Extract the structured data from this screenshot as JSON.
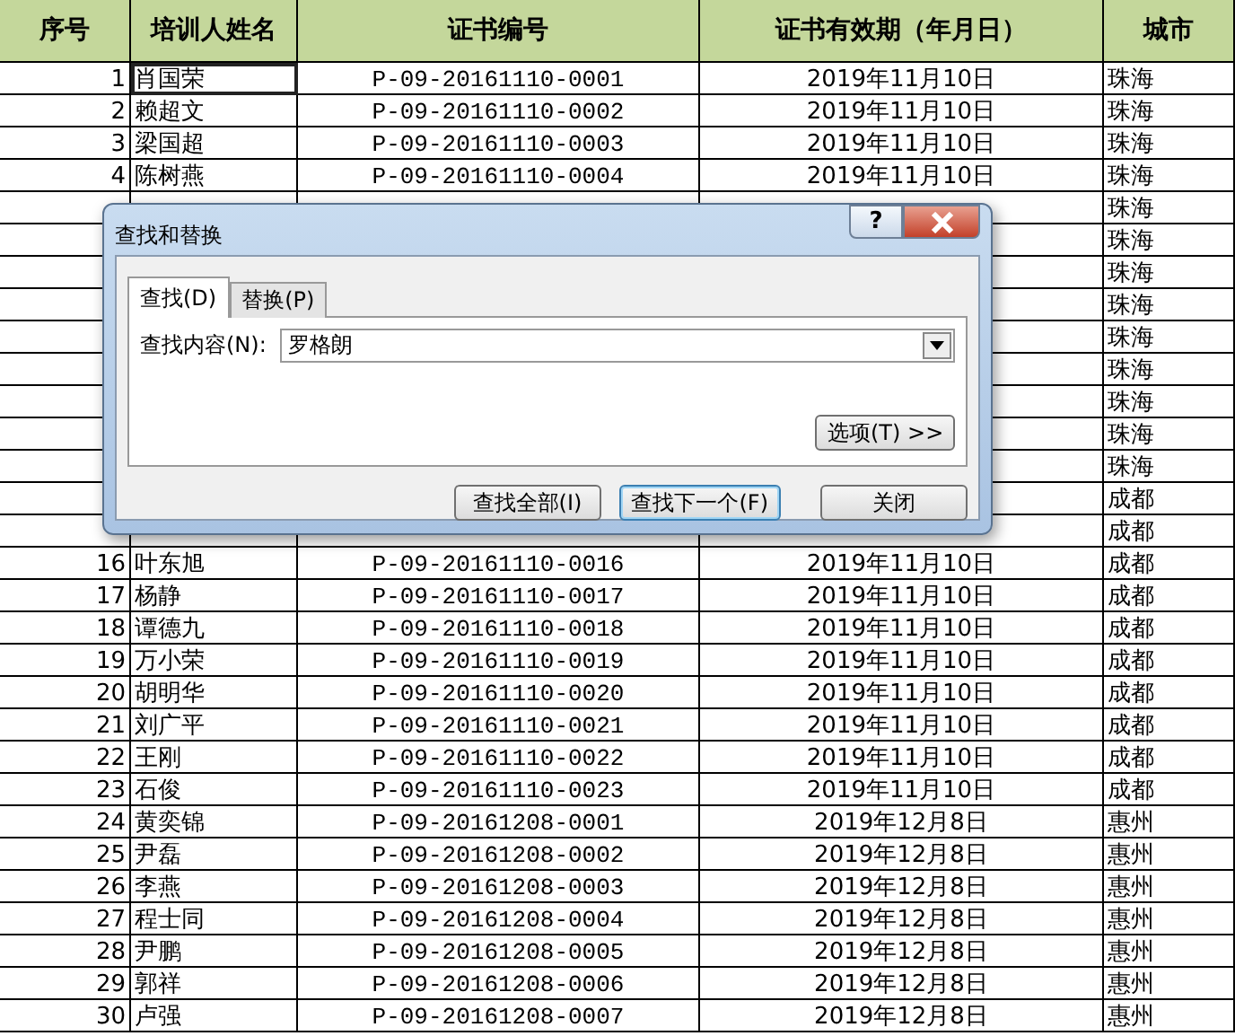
{
  "table": {
    "columns": [
      "序号",
      "培训人姓名",
      "证书编号",
      "证书有效期（年月日）",
      "城市"
    ],
    "rows": [
      {
        "seq": "1",
        "name": "肖国荣",
        "cert": "P-09-20161110-0001",
        "date": "2019年11月10日",
        "city": "珠海",
        "selected": true
      },
      {
        "seq": "2",
        "name": "赖超文",
        "cert": "P-09-20161110-0002",
        "date": "2019年11月10日",
        "city": "珠海",
        "selected": false
      },
      {
        "seq": "3",
        "name": "梁国超",
        "cert": "P-09-20161110-0003",
        "date": "2019年11月10日",
        "city": "珠海",
        "selected": false
      },
      {
        "seq": "4",
        "name": "陈树燕",
        "cert": "P-09-20161110-0004",
        "date": "2019年11月10日",
        "city": "珠海",
        "selected": false
      },
      {
        "city": "珠海"
      },
      {
        "city": "珠海"
      },
      {
        "city": "珠海"
      },
      {
        "city": "珠海"
      },
      {
        "city": "珠海"
      },
      {
        "city": "珠海"
      },
      {
        "city": "珠海"
      },
      {
        "city": "珠海"
      },
      {
        "city": "珠海"
      },
      {
        "city": "成都"
      },
      {
        "city": "成都"
      },
      {
        "seq": "16",
        "name": "叶东旭",
        "cert": "P-09-20161110-0016",
        "date": "2019年11月10日",
        "city": "成都",
        "selected": false
      },
      {
        "seq": "17",
        "name": "杨静",
        "cert": "P-09-20161110-0017",
        "date": "2019年11月10日",
        "city": "成都",
        "selected": false
      },
      {
        "seq": "18",
        "name": "谭德九",
        "cert": "P-09-20161110-0018",
        "date": "2019年11月10日",
        "city": "成都",
        "selected": false
      },
      {
        "seq": "19",
        "name": "万小荣",
        "cert": "P-09-20161110-0019",
        "date": "2019年11月10日",
        "city": "成都",
        "selected": false
      },
      {
        "seq": "20",
        "name": "胡明华",
        "cert": "P-09-20161110-0020",
        "date": "2019年11月10日",
        "city": "成都",
        "selected": false
      },
      {
        "seq": "21",
        "name": "刘广平",
        "cert": "P-09-20161110-0021",
        "date": "2019年11月10日",
        "city": "成都",
        "selected": false
      },
      {
        "seq": "22",
        "name": "王刚",
        "cert": "P-09-20161110-0022",
        "date": "2019年11月10日",
        "city": "成都",
        "selected": false
      },
      {
        "seq": "23",
        "name": "石俊",
        "cert": "P-09-20161110-0023",
        "date": "2019年11月10日",
        "city": "成都",
        "selected": false
      },
      {
        "seq": "24",
        "name": "黄奕锦",
        "cert": "P-09-20161208-0001",
        "date": "2019年12月8日",
        "city": "惠州",
        "selected": false
      },
      {
        "seq": "25",
        "name": "尹磊",
        "cert": "P-09-20161208-0002",
        "date": "2019年12月8日",
        "city": "惠州",
        "selected": false
      },
      {
        "seq": "26",
        "name": "李燕",
        "cert": "P-09-20161208-0003",
        "date": "2019年12月8日",
        "city": "惠州",
        "selected": false
      },
      {
        "seq": "27",
        "name": "程士同",
        "cert": "P-09-20161208-0004",
        "date": "2019年12月8日",
        "city": "惠州",
        "selected": false
      },
      {
        "seq": "28",
        "name": "尹鹏",
        "cert": "P-09-20161208-0005",
        "date": "2019年12月8日",
        "city": "惠州",
        "selected": false
      },
      {
        "seq": "29",
        "name": "郭祥",
        "cert": "P-09-20161208-0006",
        "date": "2019年12月8日",
        "city": "惠州",
        "selected": false
      },
      {
        "seq": "30",
        "name": "卢强",
        "cert": "P-09-20161208-0007",
        "date": "2019年12月8日",
        "city": "惠州",
        "selected": false
      }
    ]
  },
  "dialog": {
    "title": "查找和替换",
    "help": "?",
    "tabs": [
      {
        "label": "查找(D)",
        "selected": true
      },
      {
        "label": "替换(P)",
        "selected": false
      }
    ],
    "find_label": "查找内容(N):",
    "find_value": "罗格朗",
    "options_button": "选项(T) >>",
    "buttons": [
      {
        "label": "查找全部(I)",
        "default": false
      },
      {
        "label": "查找下一个(F)",
        "default": true
      },
      {
        "label": "关闭",
        "default": false
      }
    ]
  }
}
